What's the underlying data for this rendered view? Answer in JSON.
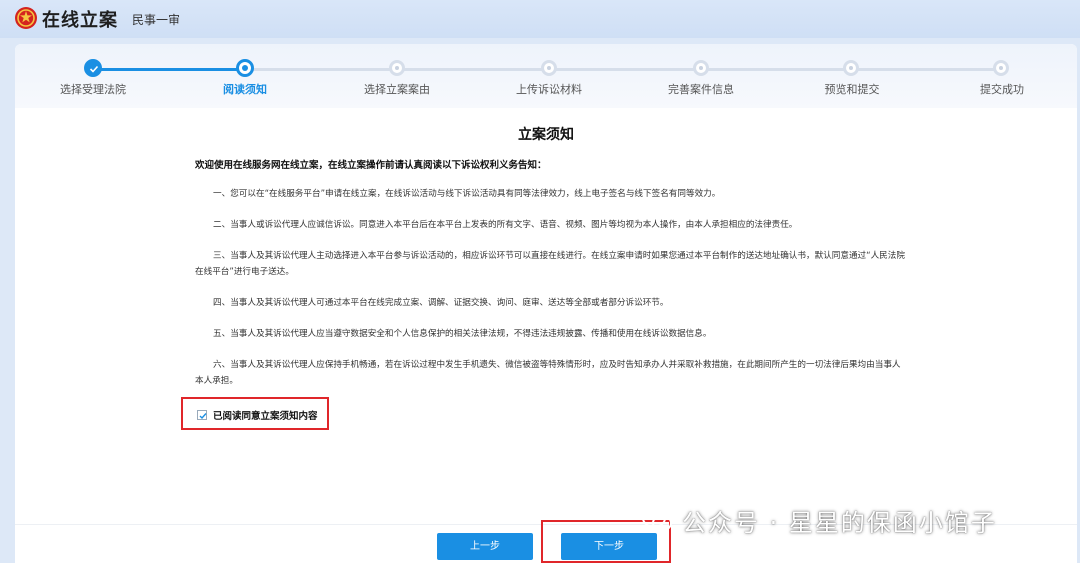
{
  "header": {
    "app_title": "在线立案",
    "case_type": "民事一审"
  },
  "stepper": {
    "steps": [
      {
        "label": "选择受理法院",
        "state": "done"
      },
      {
        "label": "阅读须知",
        "state": "active"
      },
      {
        "label": "选择立案案由",
        "state": "pending"
      },
      {
        "label": "上传诉讼材料",
        "state": "pending"
      },
      {
        "label": "完善案件信息",
        "state": "pending"
      },
      {
        "label": "预览和提交",
        "state": "pending"
      },
      {
        "label": "提交成功",
        "state": "pending"
      }
    ]
  },
  "notice": {
    "title": "立案须知",
    "intro": "欢迎使用在线服务网在线立案，在线立案操作前请认真阅读以下诉讼权利义务告知：",
    "paragraphs": [
      "一、您可以在“在线服务平台”申请在线立案，在线诉讼活动与线下诉讼活动具有同等法律效力，线上电子签名与线下签名有同等效力。",
      "二、当事人或诉讼代理人应诚信诉讼。同意进入本平台后在本平台上发表的所有文字、语音、视频、图片等均视为本人操作，由本人承担相应的法律责任。",
      "三、当事人及其诉讼代理人主动选择进入本平台参与诉讼活动的，相应诉讼环节可以直接在线进行。在线立案申请时如果您通过本平台制作的送达地址确认书，默认同意通过“人民法院在线平台”进行电子送达。",
      "四、当事人及其诉讼代理人可通过本平台在线完成立案、调解、证据交换、询问、庭审、送达等全部或者部分诉讼环节。",
      "五、当事人及其诉讼代理人应当遵守数据安全和个人信息保护的相关法律法规，不得违法违规披露、传播和使用在线诉讼数据信息。",
      "六、当事人及其诉讼代理人应保持手机畅通，若在诉讼过程中发生手机遗失、微信被盗等特殊情形时，应及时告知承办人并采取补救措施，在此期间所产生的一切法律后果均由当事人本人承担。"
    ],
    "agree_label": "已阅读同意立案须知内容",
    "agree_checked": true
  },
  "buttons": {
    "prev_label": "上一步",
    "next_label": "下一步"
  },
  "watermark": {
    "text": "公众号 · 星星的保函小馆子"
  },
  "colors": {
    "accent": "#1a8fe3",
    "highlight": "#e0262a"
  }
}
